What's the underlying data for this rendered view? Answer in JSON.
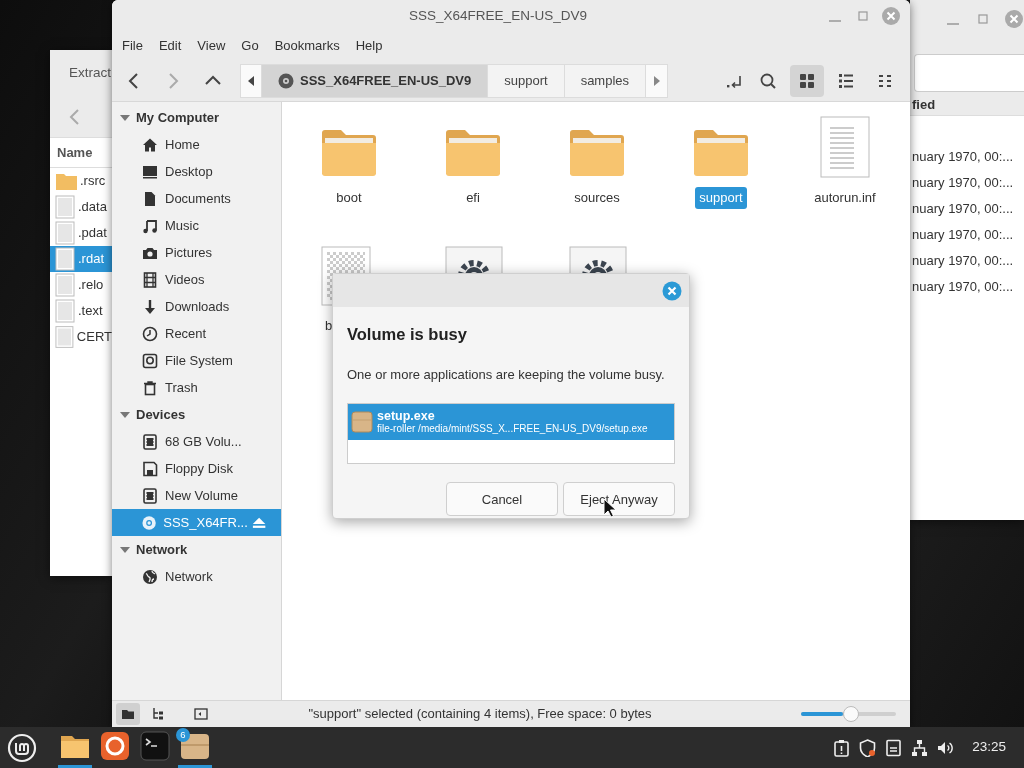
{
  "left_window": {
    "title": "Extract",
    "column_1": "Name",
    "files": [
      {
        "name": ".rsrc",
        "kind": "folder",
        "selected": false
      },
      {
        "name": ".data",
        "kind": "file",
        "selected": false
      },
      {
        "name": ".pdat",
        "kind": "file",
        "selected": false
      },
      {
        "name": ".rdat",
        "kind": "file",
        "selected": true
      },
      {
        "name": ".relo",
        "kind": "file",
        "selected": false
      },
      {
        "name": ".text",
        "kind": "file",
        "selected": false
      },
      {
        "name": "CERT",
        "kind": "file",
        "selected": false
      }
    ]
  },
  "right_window": {
    "column_1": "fied",
    "rows": [
      "nuary 1970, 00:...",
      "nuary 1970, 00:...",
      "nuary 1970, 00:...",
      "nuary 1970, 00:...",
      "nuary 1970, 00:...",
      "nuary 1970, 00:..."
    ]
  },
  "main_window": {
    "title": "SSS_X64FREE_EN-US_DV9",
    "menu": [
      "File",
      "Edit",
      "View",
      "Go",
      "Bookmarks",
      "Help"
    ],
    "path": [
      {
        "label": "SSS_X64FREE_EN-US_DV9",
        "selected": true
      },
      {
        "label": "support",
        "selected": false
      },
      {
        "label": "samples",
        "selected": false
      }
    ],
    "view_modes": [
      {
        "kind": "icons",
        "selected": true
      },
      {
        "kind": "list",
        "selected": false
      },
      {
        "kind": "compact",
        "selected": false
      }
    ],
    "sidebar": [
      {
        "heading": "My Computer",
        "expanded": true,
        "items": [
          {
            "label": "Home",
            "kind": "home",
            "selected": false,
            "ejectable": false
          },
          {
            "label": "Desktop",
            "kind": "desktop",
            "selected": false,
            "ejectable": false
          },
          {
            "label": "Documents",
            "kind": "documents",
            "selected": false,
            "ejectable": false
          },
          {
            "label": "Music",
            "kind": "music",
            "selected": false,
            "ejectable": false
          },
          {
            "label": "Pictures",
            "kind": "pictures",
            "selected": false,
            "ejectable": false
          },
          {
            "label": "Videos",
            "kind": "videos",
            "selected": false,
            "ejectable": false
          },
          {
            "label": "Downloads",
            "kind": "downloads",
            "selected": false,
            "ejectable": false
          },
          {
            "label": "Recent",
            "kind": "recent",
            "selected": false,
            "ejectable": false
          },
          {
            "label": "File System",
            "kind": "filesystem",
            "selected": false,
            "ejectable": false
          },
          {
            "label": "Trash",
            "kind": "trash",
            "selected": false,
            "ejectable": false
          }
        ]
      },
      {
        "heading": "Devices",
        "expanded": true,
        "items": [
          {
            "label": "68 GB Volu...",
            "kind": "drive",
            "selected": false,
            "ejectable": false
          },
          {
            "label": "Floppy Disk",
            "kind": "floppy",
            "selected": false,
            "ejectable": false
          },
          {
            "label": "New Volume",
            "kind": "drive",
            "selected": false,
            "ejectable": false
          },
          {
            "label": "SSS_X64FR...",
            "kind": "disc",
            "selected": true,
            "ejectable": true
          }
        ]
      },
      {
        "heading": "Network",
        "expanded": true,
        "items": [
          {
            "label": "Network",
            "kind": "network",
            "selected": false,
            "ejectable": false
          }
        ]
      }
    ],
    "files": [
      {
        "name": "boot",
        "kind": "folder",
        "selected": false
      },
      {
        "name": "efi",
        "kind": "folder",
        "selected": false
      },
      {
        "name": "sources",
        "kind": "folder",
        "selected": false
      },
      {
        "name": "support",
        "kind": "folder",
        "selected": true
      },
      {
        "name": "autorun.inf",
        "kind": "text",
        "selected": false
      },
      {
        "name": "b",
        "kind": "image",
        "selected": false
      },
      {
        "kind": "executable",
        "selected": false
      },
      {
        "kind": "executable",
        "selected": false
      }
    ],
    "status_panes": [
      {
        "kind": "places",
        "selected": true
      },
      {
        "kind": "tree",
        "selected": false
      }
    ],
    "status": "\"support\" selected (containing 4 items), Free space: 0 bytes",
    "zoom": {
      "level": 0.48
    }
  },
  "dialog": {
    "title": "Volume is busy",
    "message": "One or more applications are keeping the volume busy.",
    "processes": [
      {
        "name": "setup.exe",
        "detail": "file-roller /media/mint/SSS_X...FREE_EN-US_DV9/setup.exe",
        "selected": true
      }
    ],
    "buttons": [
      "Cancel",
      "Eject Anyway"
    ]
  },
  "taskbar": {
    "apps": [
      {
        "kind": "files",
        "running": true
      },
      {
        "kind": "browser",
        "running": false
      },
      {
        "kind": "terminal",
        "running": false
      },
      {
        "kind": "archive",
        "running": true,
        "badge": "6"
      }
    ],
    "tray": [
      {
        "kind": "clipboard"
      },
      {
        "kind": "shield"
      },
      {
        "kind": "notes"
      },
      {
        "kind": "network"
      },
      {
        "kind": "volume"
      }
    ],
    "clock": "23:25"
  }
}
